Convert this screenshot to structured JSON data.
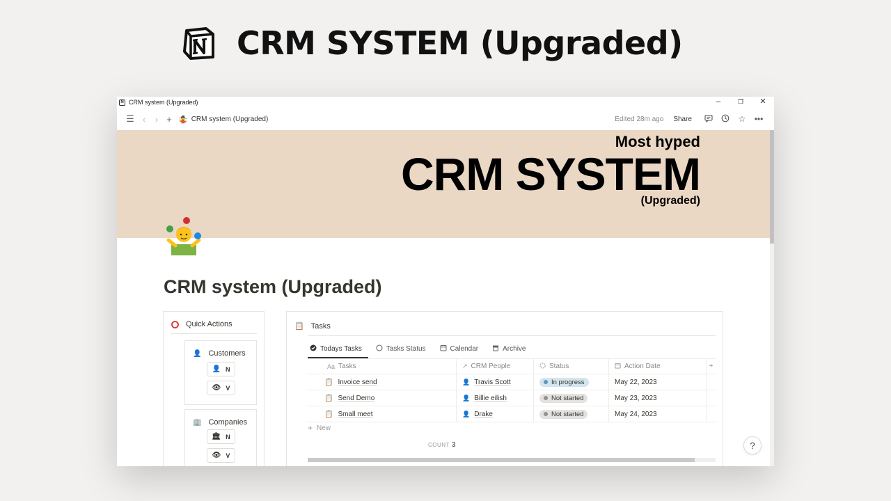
{
  "banner": {
    "title": "CRM SYSTEM (Upgraded)"
  },
  "window": {
    "title": "CRM system (Upgraded)",
    "controls": {
      "minimize": "–",
      "restore": "❐",
      "close": "✕"
    }
  },
  "toolbar": {
    "breadcrumb": "CRM system (Upgraded)",
    "edited": "Edited 28m ago",
    "share": "Share"
  },
  "cover": {
    "line1": "Most hyped",
    "line2": "CRM SYSTEM",
    "line3": "(Upgraded)"
  },
  "page": {
    "title": "CRM system (Upgraded)"
  },
  "quick_actions": {
    "title": "Quick Actions",
    "cards": [
      {
        "title": "Customers",
        "icon": "person-icon",
        "buttons": [
          {
            "label": "N",
            "icon": "person-icon"
          },
          {
            "label": "V",
            "icon": "eye-icon"
          }
        ]
      },
      {
        "title": "Companies",
        "icon": "building-icon",
        "buttons": [
          {
            "label": "N",
            "icon": "bank-icon"
          },
          {
            "label": "V",
            "icon": "eye-icon"
          }
        ]
      }
    ]
  },
  "tasks": {
    "title": "Tasks",
    "tabs": [
      {
        "label": "Todays Tasks",
        "active": true
      },
      {
        "label": "Tasks Status",
        "active": false
      },
      {
        "label": "Calendar",
        "active": false
      },
      {
        "label": "Archive",
        "active": false
      }
    ],
    "columns": {
      "tasks": "Tasks",
      "people": "CRM People",
      "status": "Status",
      "date": "Action Date",
      "title_prefix": "Aa"
    },
    "rows": [
      {
        "task": "Invoice send",
        "person": "Travis Scott",
        "status": "In progress",
        "date": "May 22, 2023"
      },
      {
        "task": "Send Demo",
        "person": "Billie eilish",
        "status": "Not started",
        "date": "May 23, 2023"
      },
      {
        "task": "Small meet",
        "person": "Drake",
        "status": "Not started",
        "date": "May 24, 2023"
      }
    ],
    "new_label": "New",
    "count_label": "COUNT",
    "count_value": "3"
  },
  "help": "?",
  "colors": {
    "in_progress_bg": "#d3e5ef",
    "in_progress_dot": "#5b97bd",
    "not_started_bg": "#e3e2e0",
    "not_started_dot": "#91918e",
    "cover_bg": "#ead7c4",
    "accent_red": "#e03e3e"
  }
}
